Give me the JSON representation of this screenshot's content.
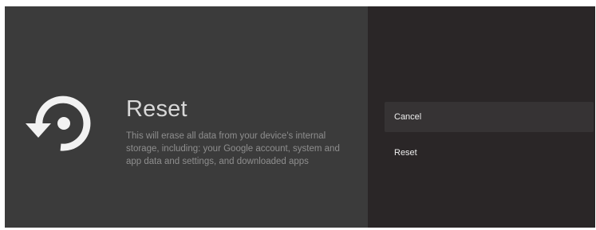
{
  "dialog": {
    "title": "Reset",
    "description": "This will erase all data from your device's internal storage, including: your Google account, system and app data and settings, and downloaded apps",
    "icon": "reset-icon"
  },
  "options": [
    {
      "label": "Cancel",
      "focused": true
    },
    {
      "label": "Reset",
      "focused": false
    }
  ],
  "colors": {
    "left_pane": "#3b3b3b",
    "right_pane": "#2a2627",
    "focus_highlight": "#363334",
    "title_text": "#d8d8d8",
    "description_text": "#8e8e8e"
  }
}
